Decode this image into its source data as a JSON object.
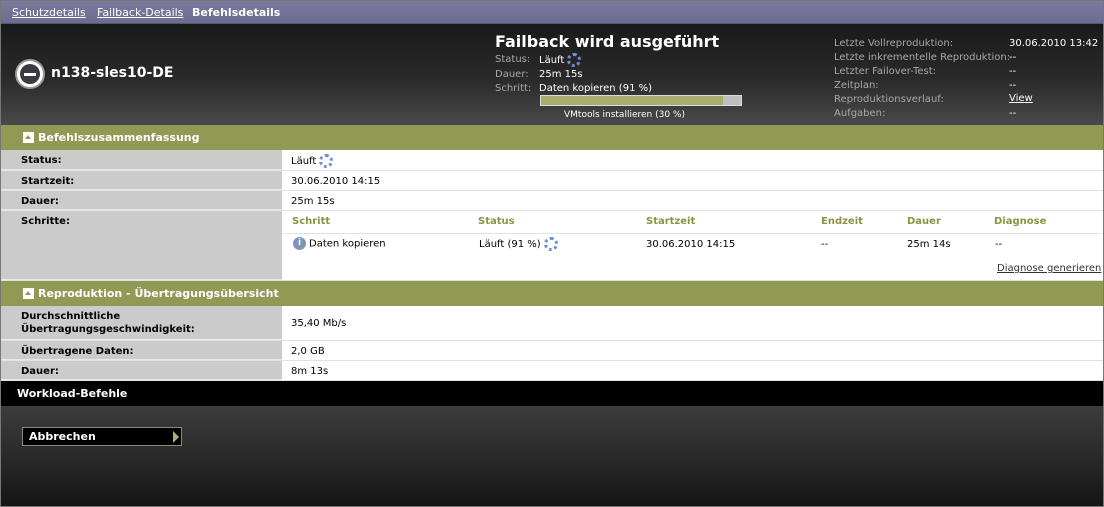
{
  "tabs": [
    {
      "label": "Schutzdetails"
    },
    {
      "label": "Failback-Details"
    },
    {
      "label": "Befehlsdetails"
    }
  ],
  "workload": {
    "name": "n138-sles10-DE"
  },
  "operation": {
    "title": "Failback wird ausgeführt",
    "status_label": "Status:",
    "status_value": "Läuft",
    "duration_label": "Dauer:",
    "duration_value": "25m 15s",
    "step_label": "Schritt:",
    "step_value": "Daten kopieren (91 %)",
    "progress_percent": 91,
    "sub_status": "VMtools installieren (30 %)"
  },
  "info": [
    {
      "label": "Letzte Vollreproduktion:",
      "value": "30.06.2010 13:42"
    },
    {
      "label": "Letzte inkrementelle Reproduktion:",
      "value": "--"
    },
    {
      "label": "Letzter Failover-Test:",
      "value": "--"
    },
    {
      "label": "Zeitplan:",
      "value": "--"
    },
    {
      "label": "Reproduktionsverlauf:",
      "value": "View"
    },
    {
      "label": "Aufgaben:",
      "value": "--"
    }
  ],
  "summary": {
    "title": "Befehlszusammenfassung",
    "status_label": "Status:",
    "status_value": "Läuft",
    "start_label": "Startzeit:",
    "start_value": "30.06.2010 14:15",
    "duration_label": "Dauer:",
    "duration_value": "25m 15s",
    "steps_label": "Schritte:",
    "steps_headers": [
      "Schritt",
      "Status",
      "Startzeit",
      "Endzeit",
      "Dauer",
      "Diagnose"
    ],
    "steps_rows": [
      {
        "step": "Daten kopieren",
        "status": "Läuft (91 %)",
        "start": "30.06.2010 14:15",
        "end": "--",
        "duration": "25m 14s",
        "diagnosis": "--"
      }
    ],
    "diagnose_link": "Diagnose generieren"
  },
  "replication": {
    "title": "Reproduktion - Übertragungsübersicht",
    "speed_label_1": "Durchschnittliche",
    "speed_label_2": "Übertragungsgeschwindigkeit:",
    "speed_value": "35,40 Mb/s",
    "data_label": "Übertragene Daten:",
    "data_value": "2,0 GB",
    "duration_label": "Dauer:",
    "duration_value": "8m 13s"
  },
  "commands": {
    "title": "Workload-Befehle",
    "abort_label": "Abbrechen"
  },
  "colors": {
    "tab_bar": "#7a7a9e",
    "section_bar": "#919a55",
    "step_header": "#8d9343",
    "progress_fill": "#a9ad6e"
  }
}
